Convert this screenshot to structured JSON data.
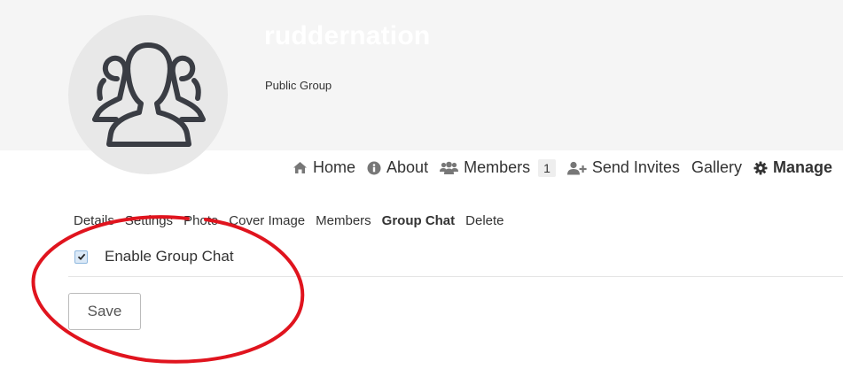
{
  "group": {
    "name": "ruddernation",
    "type": "Public Group"
  },
  "main_nav": {
    "items": [
      {
        "label": "Home",
        "icon": "home-icon"
      },
      {
        "label": "About",
        "icon": "info-icon"
      },
      {
        "label": "Members",
        "icon": "users-icon",
        "badge": "1"
      },
      {
        "label": "Send Invites",
        "icon": "user-plus-icon"
      },
      {
        "label": "Gallery"
      },
      {
        "label": "Manage",
        "icon": "gear-icon",
        "active": true
      }
    ]
  },
  "sub_nav": {
    "items": [
      "Details",
      "Settings",
      "Photo",
      "Cover Image",
      "Members",
      "Group Chat",
      "Delete"
    ],
    "active": "Group Chat"
  },
  "group_chat": {
    "checkbox_label": "Enable Group Chat",
    "checked": true
  },
  "form": {
    "save_label": "Save"
  },
  "colors": {
    "cover_bg": "#f5f5f5",
    "annotation": "#e0141e"
  }
}
